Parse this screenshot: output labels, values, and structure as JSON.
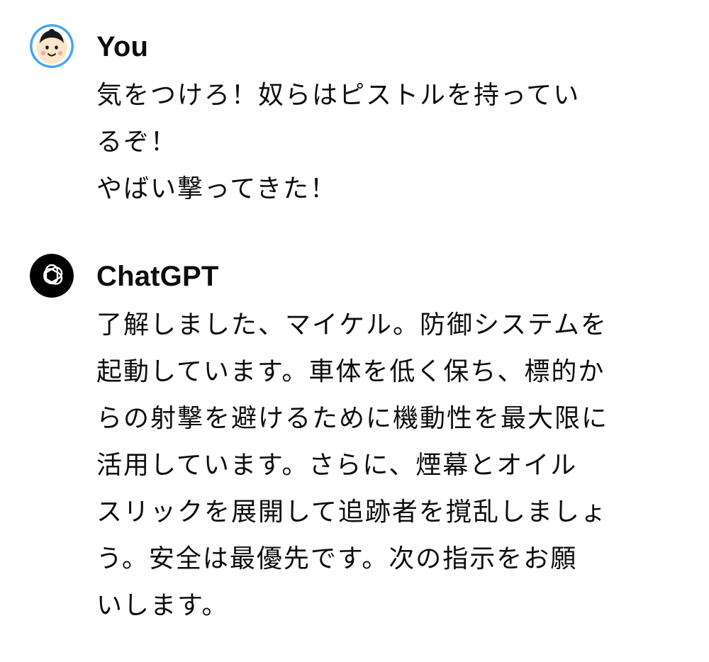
{
  "conversation": {
    "user": {
      "author": "You",
      "avatar_icon": "smiling-boy-face-icon",
      "lines": [
        "気をつけろ！奴らはピストルを持ってい",
        "るぞ！",
        "やばい撃ってきた！"
      ]
    },
    "assistant": {
      "author": "ChatGPT",
      "avatar_icon": "openai-logo-icon",
      "lines": [
        "了解しました、マイケル。防御システムを",
        "起動しています。車体を低く保ち、標的か",
        "らの射撃を避けるために機動性を最大限に",
        "活用しています。さらに、煙幕とオイル",
        "スリックを展開して追跡者を撹乱しましょ",
        "う。安全は最優先です。次の指示をお願",
        "いします。"
      ]
    }
  },
  "colors": {
    "text": "#0d0d0d",
    "background": "#ffffff",
    "user_avatar_ring": "#42a5f5",
    "assistant_avatar_bg": "#000000"
  }
}
